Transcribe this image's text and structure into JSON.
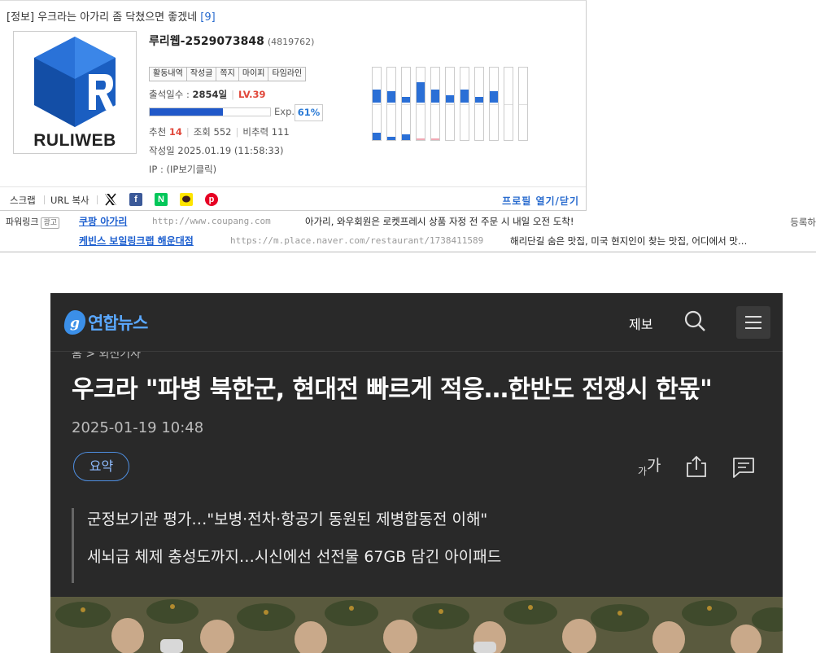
{
  "post": {
    "category": "[정보]",
    "title": "우크라는 아가리 좀 닥쳤으면 좋겠네",
    "comment_count": "[9]"
  },
  "profile": {
    "logo_text": "RULIWEB",
    "nickname": "루리웹-2529073848",
    "user_id": "(4819762)",
    "buttons": [
      "활동내역",
      "작성글",
      "쪽지",
      "마이피",
      "타임라인"
    ],
    "attendance_label": "출석일수 :",
    "attendance_value": "2854일",
    "level": "LV.39",
    "exp_label": "Exp.",
    "exp_percent": "61%",
    "exp_fraction": 0.61,
    "recommend_label": "추천",
    "recommend_value": "14",
    "views_label": "조회",
    "views_value": "552",
    "ratio_label": "비추력",
    "ratio_value": "111",
    "written_label": "작성일",
    "written_value": "2025.01.19 (11:58:33)",
    "ip_label": "IP :",
    "ip_value": "(IP보기클릭)"
  },
  "activity_chart": {
    "upper": [
      0.35,
      0.3,
      0.15,
      0.55,
      0.35,
      0.2,
      0.35,
      0.15,
      0.3,
      0,
      0
    ],
    "lower": [
      0.2,
      0.08,
      0.15,
      0.05,
      0.05,
      0,
      0,
      0,
      0,
      0,
      0
    ],
    "lower_pink": [
      false,
      false,
      false,
      true,
      true,
      false,
      false,
      false,
      false,
      false,
      false
    ]
  },
  "share": {
    "scrap": "스크랩",
    "url_copy": "URL 복사",
    "profile_toggle": "프로필 열기/닫기",
    "icons": [
      "x-icon",
      "facebook-icon",
      "naver-icon",
      "kakao-icon",
      "pinterest-icon"
    ]
  },
  "powerlink": {
    "label": "파워링크",
    "badge": "광고",
    "register": "등록하",
    "ads": [
      {
        "name": "쿠팡 아가리",
        "url": "http://www.coupang.com",
        "desc": "아가리, 와우회원은 로켓프레시 상품 자정 전 주문 시 내일 오전 도착!"
      },
      {
        "name": "케빈스 보일링크랩 해운대점",
        "url": "https://m.place.naver.com/restaurant/1738411589",
        "desc": "해리단길 숨은 맛집, 미국 현지인이 찾는 맛집, 어디에서 맛…"
      }
    ]
  },
  "news": {
    "brand": "연합뉴스",
    "tip": "제보",
    "breadcrumb": "홈 > 외신기사",
    "headline": "우크라 \"파병 북한군, 현대전 빠르게 적응…한반도 전쟁시 한몫\"",
    "date": "2025-01-19 10:48",
    "summary_button": "요약",
    "font_small": "가",
    "font_big": "가",
    "summary": [
      "군정보기관 평가…\"보병·전차·항공기 동원된 제병합동전 이해\"",
      "세뇌급 체제 충성도까지…시신에선 선전물 67GB 담긴 아이패드"
    ],
    "colors": {
      "background": "#292929",
      "brand": "#5aa8ff",
      "accent": "#4e8ee0"
    }
  }
}
